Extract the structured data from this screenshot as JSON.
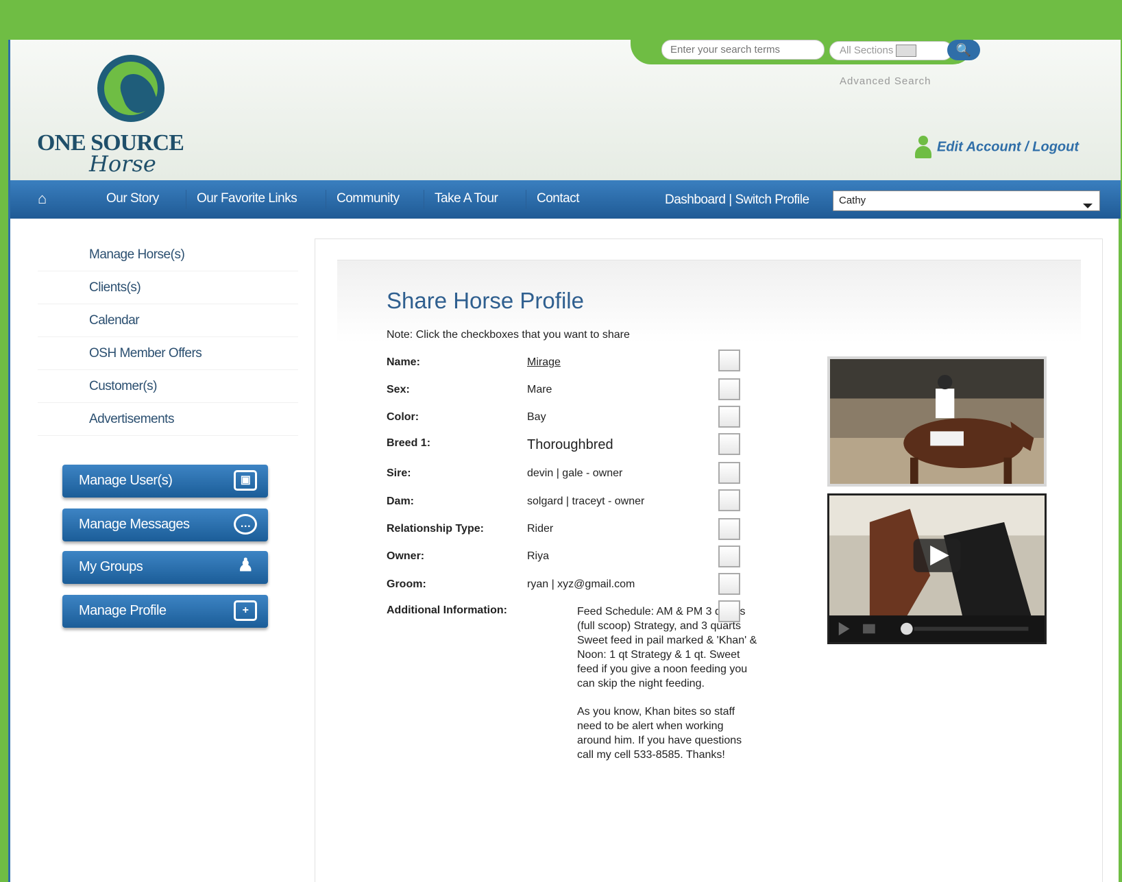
{
  "header": {
    "logo_name": "ONE SOURCE",
    "logo_script": "Horse",
    "search_placeholder": "Enter your search terms",
    "sections_label": "All Sections",
    "advanced_search": "Advanced Search",
    "edit_account": "Edit Account / Logout"
  },
  "nav": {
    "items": [
      "Our Story",
      "Our Favorite Links",
      "Community",
      "Take A Tour",
      "Contact"
    ],
    "dashboard": "Dashboard |",
    "switch_profile": "Switch Profile",
    "profile_value": "Cathy"
  },
  "sidebar": {
    "items": [
      "Manage Horse(s)",
      "Clients(s)",
      "Calendar",
      "OSH Member Offers",
      "Customer(s)",
      "Advertisements"
    ],
    "buttons": [
      "Manage User(s)",
      "Manage Messages",
      "My Groups",
      "Manage Profile"
    ]
  },
  "main": {
    "title": "Share Horse Profile",
    "note": "Note: Click the checkboxes that you want to share",
    "fields": [
      {
        "label": "Name:",
        "value": "Mirage"
      },
      {
        "label": "Sex:",
        "value": "Mare"
      },
      {
        "label": "Color:",
        "value": "Bay"
      },
      {
        "label": "Breed 1:",
        "value": "Thoroughbred"
      },
      {
        "label": "Sire:",
        "value": "devin | gale - owner"
      },
      {
        "label": "Dam:",
        "value": "solgard | traceyt - owner"
      },
      {
        "label": "Relationship Type:",
        "value": "Rider"
      },
      {
        "label": "Owner:",
        "value": "Riya"
      },
      {
        "label": "Groom:",
        "value": "ryan | xyz@gmail.com"
      },
      {
        "label": "Additional Information:",
        "value": ""
      }
    ],
    "additional_p1": "Feed Schedule: AM & PM 3 quarts (full scoop) Strategy, and 3 quarts Sweet feed in pail marked & 'Khan' & Noon: 1 qt Strategy & 1 qt. Sweet feed if you give a noon feeding you can skip the night feeding.",
    "additional_p2": "As you know, Khan bites so staff need to be alert when working around him. If you have questions call my cell 533-8585. Thanks!"
  },
  "colors": {
    "green": "#6fbd44",
    "blue": "#2f6ea8",
    "nav_dark": "#1f5a95"
  }
}
